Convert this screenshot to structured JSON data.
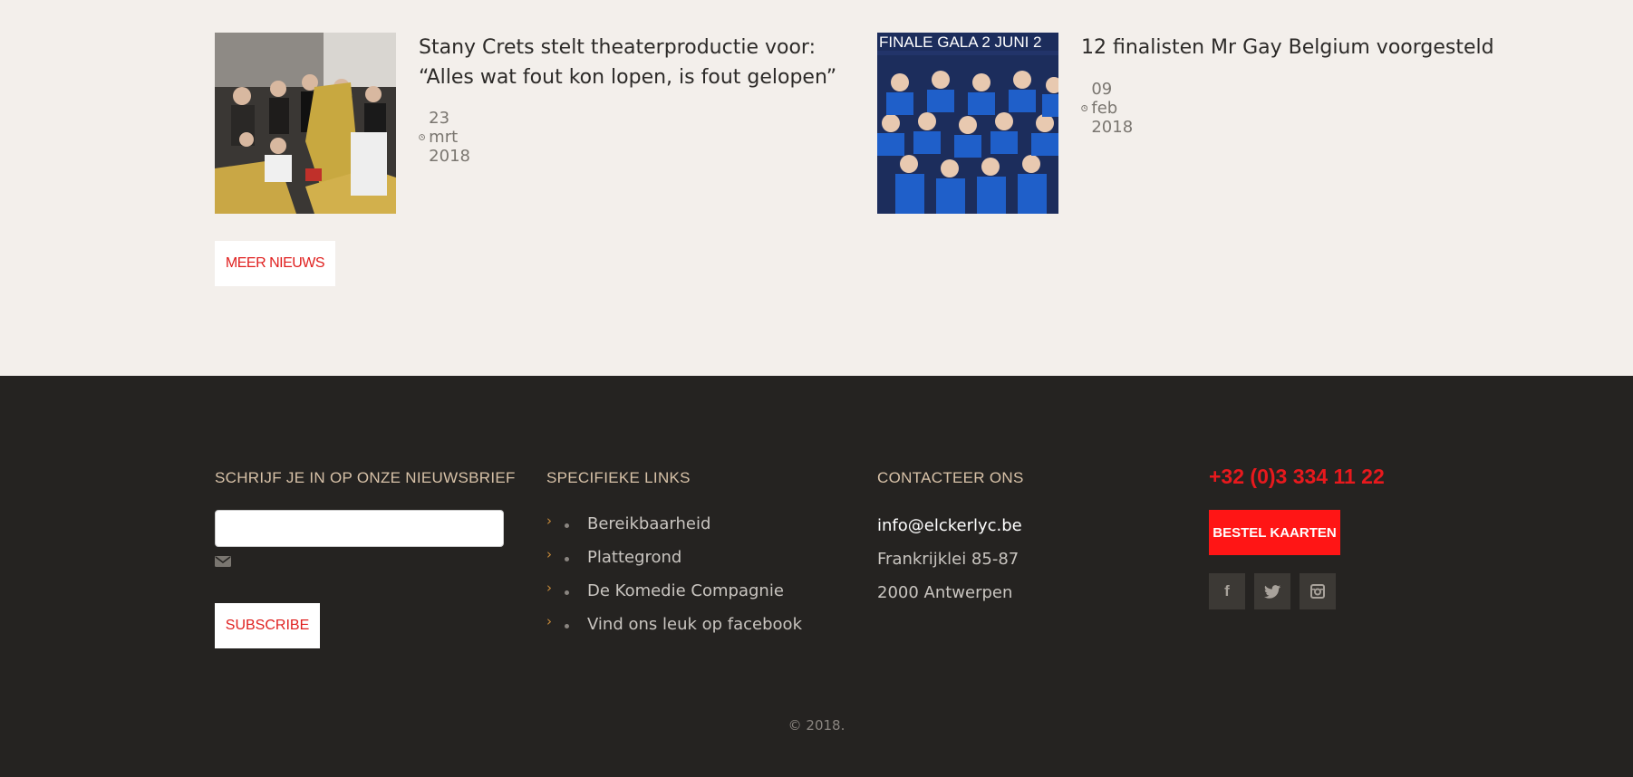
{
  "news": [
    {
      "title": "Stany Crets stelt theaterproductie voor: “Alles wat fout kon lopen, is fout gelopen”",
      "date": "23 mrt 2018",
      "date_icon": "clock-icon"
    },
    {
      "title": "12 finalisten Mr Gay Belgium voorgesteld",
      "date": "09 feb 2018",
      "date_icon": "clock-icon",
      "poster_text": "FINALE GALA 2 JUNI 2"
    }
  ],
  "meer_nieuws_label": "MEER NIEUWS",
  "footer": {
    "newsletter": {
      "heading": "SCHRIJF JE IN OP ONZE NIEUWSBRIEF",
      "input_value": "",
      "icon": "envelope-icon",
      "subscribe_label": "SUBSCRIBE"
    },
    "links": {
      "heading": "SPECIFIEKE LINKS",
      "items": [
        {
          "label": "Bereikbaarheid"
        },
        {
          "label": "Plattegrond"
        },
        {
          "label": "De Komedie Compagnie"
        },
        {
          "label": "Vind ons leuk op facebook"
        }
      ]
    },
    "contact": {
      "heading": "CONTACTEER ONS",
      "email": "info@elckerlyc.be",
      "street": "Frankrijklei 85-87",
      "city": "2000 Antwerpen"
    },
    "tickets": {
      "phone": "+32 (0)3 334 11 22",
      "button_label": "BESTEL KAARTEN",
      "social": [
        "facebook-icon",
        "twitter-icon",
        "instagram-icon"
      ]
    },
    "copyright": "© 2018."
  },
  "colors": {
    "accent_red": "#e8191d",
    "footer_bg": "#252321",
    "page_bg": "#f3efeb",
    "heading_tan": "#d8c2a8"
  }
}
